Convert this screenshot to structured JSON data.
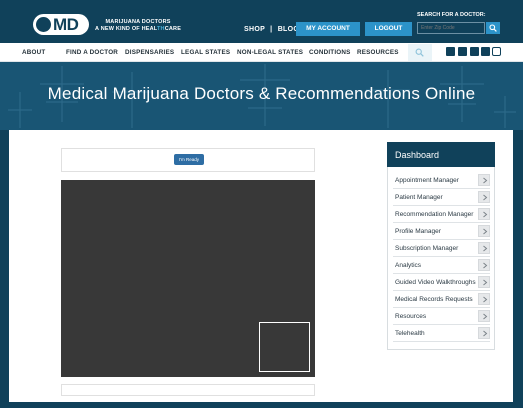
{
  "header": {
    "logo_text": "MD",
    "tagline_line1": "MARIJUANA DOCTORS",
    "tagline_prefix": "A NEW KIND OF HEAL",
    "tagline_accent": "TH",
    "tagline_suffix": "CARE",
    "shop_label": "SHOP",
    "separator": "|",
    "blog_label": "BLOG",
    "my_account_label": "MY ACCOUNT",
    "logout_label": "LOGOUT",
    "search_label": "SEARCH FOR A DOCTOR:",
    "search_placeholder": "Enter Zip Code"
  },
  "nav": {
    "items": [
      "ABOUT",
      "FIND A DOCTOR",
      "DISPENSARIES",
      "LEGAL STATES",
      "NON-LEGAL STATES",
      "CONDITIONS",
      "RESOURCES"
    ],
    "social_icons": [
      "facebook-icon",
      "google-plus-icon",
      "twitter-icon",
      "youtube-icon",
      "instagram-icon"
    ]
  },
  "hero": {
    "title": "Medical Marijuana Doctors & Recommendations Online"
  },
  "main": {
    "ready_button": "I'm Ready"
  },
  "dashboard": {
    "title": "Dashboard",
    "items": [
      "Appointment Manager",
      "Patient Manager",
      "Recommendation Manager",
      "Profile Manager",
      "Subscription Manager",
      "Analytics",
      "Guided Video Walkthroughs",
      "Medical Records Requests",
      "Resources",
      "Telehealth"
    ]
  },
  "colors": {
    "brand_navy": "#10415a",
    "hero_blue": "#195574",
    "accent_blue": "#2c93c9",
    "button_blue": "#2e6da4",
    "video_bg": "#383838"
  }
}
